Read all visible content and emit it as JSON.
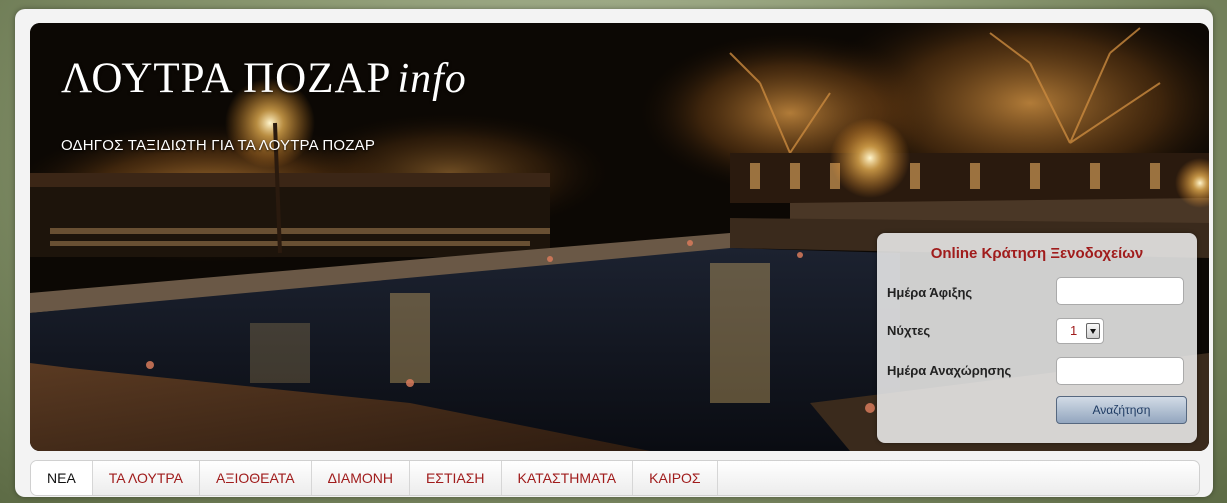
{
  "header": {
    "site_title": "ΛΟΥΤΡΑ ΠΟΖΑΡ",
    "site_title_suffix": "info",
    "tagline": "ΟΔΗΓΟΣ ΤΑΞΙΔΙΩΤΗ ΓΙΑ ΤΑ ΛΟΥΤΡΑ ΠΟΖΑΡ"
  },
  "booking": {
    "title": "Online Κράτηση Ξενοδοχείων",
    "arrival_label": "Ημέρα Άφιξης",
    "arrival_value": "",
    "nights_label": "Νύχτες",
    "nights_value": "1",
    "departure_label": "Ημέρα Αναχώρησης",
    "departure_value": "",
    "search_label": "Αναζήτηση"
  },
  "nav": {
    "items": [
      {
        "label": "ΝΕΑ",
        "active": true
      },
      {
        "label": "ΤΑ ΛΟΥΤΡΑ",
        "active": false
      },
      {
        "label": "ΑΞΙΟΘΕΑΤΑ",
        "active": false
      },
      {
        "label": "ΔΙΑΜΟΝΗ",
        "active": false
      },
      {
        "label": "ΕΣΤΙΑΣΗ",
        "active": false
      },
      {
        "label": "ΚΑΤΑΣΤΗΜΑΤΑ",
        "active": false
      },
      {
        "label": "ΚΑΙΡΟΣ",
        "active": false
      }
    ]
  },
  "colors": {
    "accent_red": "#a01c1c",
    "button_blue": "#93a6bf"
  }
}
